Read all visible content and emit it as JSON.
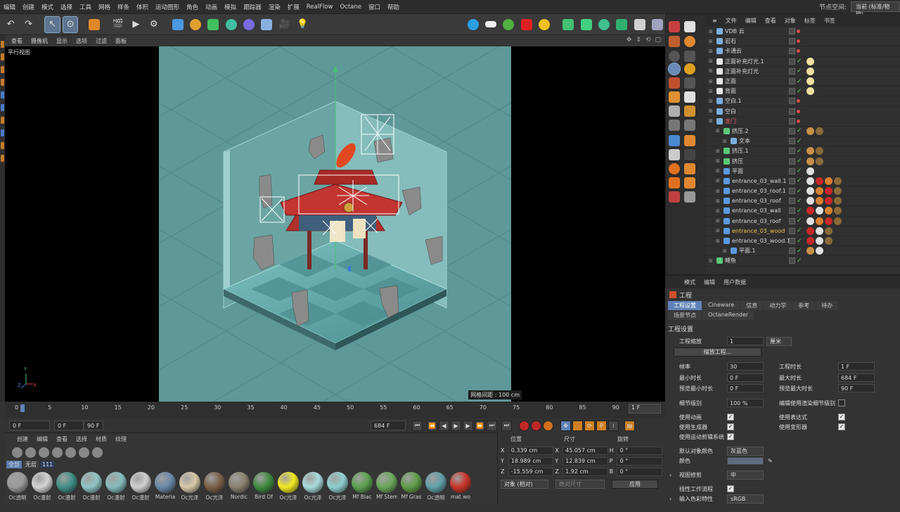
{
  "menu": {
    "items": [
      "编辑",
      "创建",
      "模式",
      "选择",
      "工具",
      "网格",
      "样条",
      "体积",
      "运动图形",
      "角色",
      "动画",
      "模拟",
      "跟踪器",
      "渲染",
      "扩展",
      "RealFlow",
      "Octane",
      "窗口",
      "帮助"
    ],
    "node_space_label": "节点空间:",
    "node_space_value": "当前 (标准/物理)"
  },
  "viewport": {
    "menu": [
      "查看",
      "摄像机",
      "显示",
      "选项",
      "过滤",
      "面板"
    ],
    "title": "平行视图",
    "grid_info": "网格间距 : 100 cm",
    "axis": {
      "y": "Y",
      "z": "Z",
      "x": "X"
    }
  },
  "timeline": {
    "ticks": [
      "0",
      "5",
      "10",
      "15",
      "20",
      "25",
      "30",
      "35",
      "40",
      "45",
      "50",
      "55",
      "60",
      "65",
      "70",
      "75",
      "80",
      "85",
      "90"
    ],
    "current_frame": "1 F"
  },
  "transport": {
    "start": "0 F",
    "preview_start": "0 F",
    "preview_end": "90 F",
    "end": "684 F"
  },
  "material_manager": {
    "menu": [
      "创建",
      "编辑",
      "查看",
      "选择",
      "材质",
      "纹理"
    ],
    "tabs": [
      "全部",
      "无层"
    ],
    "count": "111",
    "materials": [
      {
        "label": "Oc透明",
        "color": "#9a9a9a"
      },
      {
        "label": "Oc漫射",
        "color": "#d4d4d4"
      },
      {
        "label": "Oc漫射",
        "color": "#3f8f86"
      },
      {
        "label": "Oc漫射",
        "color": "#8fc5c4"
      },
      {
        "label": "Oc漫射",
        "color": "#86bdbd"
      },
      {
        "label": "Oc漫射",
        "color": "#d0d0d0"
      },
      {
        "label": "Materia",
        "color": "#6a88a8"
      },
      {
        "label": "Oc光泽",
        "color": "#d8c8a8"
      },
      {
        "label": "Oc光泽",
        "color": "#7a6048"
      },
      {
        "label": "Nordic",
        "color": "#8a8270"
      },
      {
        "label": "Bird Of",
        "color": "#3f8a3f"
      },
      {
        "label": "Oc光泽",
        "color": "#f2ea20"
      },
      {
        "label": "Oc光泽",
        "color": "#a8dcdc"
      },
      {
        "label": "Oc光泽",
        "color": "#8ed0d0"
      },
      {
        "label": "Mf Blac",
        "color": "#5aa04e"
      },
      {
        "label": "Mf Stem",
        "color": "#6aa85a"
      },
      {
        "label": "Mf Gras",
        "color": "#5e9e48"
      },
      {
        "label": "Oc透明",
        "color": "#60a0a8"
      },
      {
        "label": "mat wo",
        "color": "#c83428"
      }
    ]
  },
  "coords": {
    "headers": {
      "position": "位置",
      "size": "尺寸",
      "rotation": "旋转"
    },
    "rows": [
      {
        "axis": "X",
        "pos": "0.339 cm",
        "saxis": "X",
        "size": "45.057 cm",
        "raxis": "H",
        "rot": "0 °"
      },
      {
        "axis": "Y",
        "pos": "18.989 cm",
        "saxis": "Y",
        "size": "12.839 cm",
        "raxis": "P",
        "rot": "0 °"
      },
      {
        "axis": "Z",
        "pos": "-15.559 cm",
        "saxis": "Z",
        "size": "1.92 cm",
        "raxis": "B",
        "rot": "0 °"
      }
    ],
    "mode": "对象 (相对)",
    "size_mode": "绝对尺寸",
    "apply": "应用"
  },
  "object_manager": {
    "menu": [
      "文件",
      "编辑",
      "查看",
      "对象",
      "标签",
      "书签"
    ],
    "objects": [
      {
        "name": "VDB 云",
        "indent": 0,
        "icon": "#7ab0e0",
        "style": "",
        "dot": true,
        "tags": []
      },
      {
        "name": "岩石",
        "indent": 0,
        "icon": "#7ab0e0",
        "style": "",
        "dot": true,
        "tags": []
      },
      {
        "name": "卡通云",
        "indent": 0,
        "icon": "#7ab0e0",
        "style": "",
        "dot": true,
        "tags": []
      },
      {
        "name": "正面补充灯光.1",
        "indent": 0,
        "icon": "#e8e8e8",
        "style": "",
        "dot": false,
        "tags": [
          "#f0e0a0"
        ]
      },
      {
        "name": "正面补充灯光",
        "indent": 0,
        "icon": "#e8e8e8",
        "style": "",
        "dot": false,
        "tags": [
          "#f0e0a0"
        ]
      },
      {
        "name": "正面",
        "indent": 0,
        "icon": "#e8e8e8",
        "style": "",
        "dot": false,
        "tags": [
          "#f0e0a0"
        ]
      },
      {
        "name": "背面",
        "indent": 0,
        "icon": "#e8e8e8",
        "style": "",
        "dot": false,
        "tags": [
          "#f0e0a0"
        ]
      },
      {
        "name": "空白.1",
        "indent": 0,
        "icon": "#7ab0e0",
        "style": "",
        "dot": true,
        "tags": []
      },
      {
        "name": "空白",
        "indent": 0,
        "icon": "#7ab0e0",
        "style": "",
        "dot": true,
        "tags": []
      },
      {
        "name": "龙门",
        "indent": 0,
        "icon": "#7ab0e0",
        "style": "red",
        "dot": true,
        "tags": []
      },
      {
        "name": "挤压.2",
        "indent": 1,
        "icon": "#58c878",
        "style": "",
        "dot": false,
        "tags": [
          "#c89048",
          "#8a6a38"
        ]
      },
      {
        "name": "文本",
        "indent": 2,
        "icon": "#7ab0e0",
        "style": "",
        "dot": false,
        "tags": []
      },
      {
        "name": "挤压.1",
        "indent": 1,
        "icon": "#58c878",
        "style": "",
        "dot": false,
        "tags": [
          "#c89048",
          "#8a6a38"
        ]
      },
      {
        "name": "挤压",
        "indent": 1,
        "icon": "#58c878",
        "style": "",
        "dot": false,
        "tags": [
          "#c89048",
          "#8a6a38"
        ]
      },
      {
        "name": "平面",
        "indent": 1,
        "icon": "#5a9ae0",
        "style": "",
        "dot": false,
        "tags": [
          "#e0e0e0"
        ]
      },
      {
        "name": "entrance_03_wall.1",
        "indent": 1,
        "icon": "#5a9ae0",
        "style": "",
        "dot": false,
        "tags": [
          "#e0e0e0",
          "#c82828",
          "#d88030",
          "#8a6a38"
        ]
      },
      {
        "name": "entrance_03_roof.1",
        "indent": 1,
        "icon": "#5a9ae0",
        "style": "",
        "dot": false,
        "tags": [
          "#e0e0e0",
          "#d88030",
          "#c82828",
          "#8a6a38"
        ]
      },
      {
        "name": "entrance_03_roof",
        "indent": 1,
        "icon": "#5a9ae0",
        "style": "",
        "dot": false,
        "tags": [
          "#e0e0e0",
          "#d88030",
          "#c82828",
          "#8a6a38"
        ]
      },
      {
        "name": "entrance_03_wall",
        "indent": 1,
        "icon": "#5a9ae0",
        "style": "",
        "dot": false,
        "tags": [
          "#c82828",
          "#e0e0e0",
          "#d88030",
          "#8a6a38"
        ]
      },
      {
        "name": "entrance_03_roof",
        "indent": 1,
        "icon": "#5a9ae0",
        "style": "",
        "dot": false,
        "tags": [
          "#e0e0e0",
          "#d88030",
          "#c82828",
          "#8a6a38"
        ]
      },
      {
        "name": "entrance_03_wood",
        "indent": 1,
        "icon": "#5a9ae0",
        "style": "hl",
        "dot": false,
        "tags": [
          "#c82828",
          "#e0e0e0",
          "#8a6a38"
        ]
      },
      {
        "name": "entrance_03_wood.1",
        "indent": 1,
        "icon": "#5a9ae0",
        "style": "",
        "dot": false,
        "tags": [
          "#c82828",
          "#e0e0e0",
          "#8a6a38"
        ]
      },
      {
        "name": "平面.1",
        "indent": 2,
        "icon": "#5a9ae0",
        "style": "",
        "dot": false,
        "tags": [
          "#c89048",
          "#e0e0e0"
        ]
      },
      {
        "name": "鲤鱼",
        "indent": 0,
        "icon": "#58c878",
        "style": "",
        "dot": false,
        "tags": []
      }
    ]
  },
  "attributes": {
    "menu": [
      "模式",
      "编辑",
      "用户数据"
    ],
    "title": "工程",
    "tabs": [
      "工程设置",
      "Cineware",
      "信息",
      "动力学",
      "参考",
      "待办"
    ],
    "subtabs": [
      "场景节点",
      "OctaneRender"
    ],
    "section": "工程设置",
    "project_scale_label": "工程缩放",
    "project_scale_value": "1",
    "project_scale_unit": "厘米",
    "scale_button": "缩放工程...",
    "fps_label": "帧率",
    "fps_value": "30",
    "duration_label": "工程时长",
    "duration_value": "1 F",
    "min_time_label": "最小时长",
    "min_time_value": "0 F",
    "max_time_label": "最大时长",
    "max_time_value": "684 F",
    "prev_min_label": "预览最小时长",
    "prev_min_value": "0 F",
    "prev_max_label": "预览最大时长",
    "prev_max_value": "90 F",
    "lod_label": "细节级别",
    "lod_value": "100 %",
    "render_lod_label": "编辑使用渲染细节级别",
    "use_anim": "使用动画",
    "use_expr": "使用表达式",
    "use_gen": "使用生成器",
    "use_deform": "使用变形器",
    "use_mograph": "使用运动剪辑系统",
    "default_color_label": "默认对象颜色",
    "default_color_value": "灰蓝色",
    "color_label": "颜色",
    "view_clip_label": "视图修剪",
    "view_clip_value": "中",
    "linear_label": "线性工作流程",
    "input_profile_label": "输入色彩特性",
    "input_profile_value": "sRGB"
  },
  "colors": {
    "accent": "#5f82b8",
    "room_floor": "#6fa9a8",
    "room_wall": "#5a9291",
    "roof": "#b32f2a"
  }
}
